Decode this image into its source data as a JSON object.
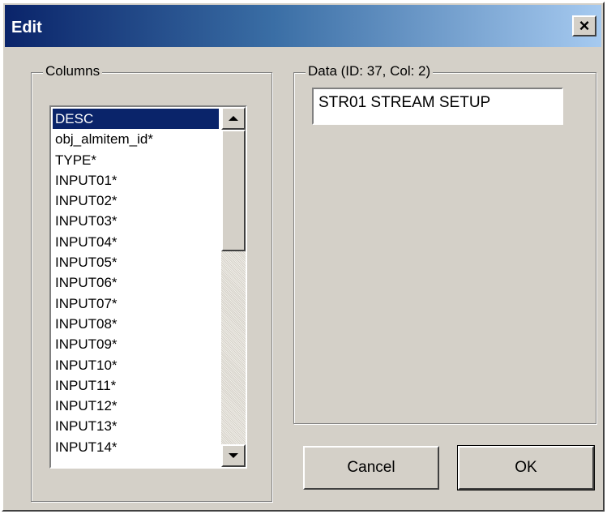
{
  "window": {
    "title": "Edit",
    "close_glyph": "×"
  },
  "columns_group": {
    "label": "Columns",
    "items": [
      "DESC",
      "obj_almitem_id*",
      "TYPE*",
      "INPUT01*",
      "INPUT02*",
      "INPUT03*",
      "INPUT04*",
      "INPUT05*",
      "INPUT06*",
      "INPUT07*",
      "INPUT08*",
      "INPUT09*",
      "INPUT10*",
      "INPUT11*",
      "INPUT12*",
      "INPUT13*",
      "INPUT14*"
    ],
    "selected_item": "DESC"
  },
  "data_group": {
    "label": "Data (ID: 37, Col: 2)",
    "value": "STR01 STREAM SETUP"
  },
  "buttons": {
    "cancel_label": "Cancel",
    "ok_label": "OK"
  },
  "colors": {
    "title_bar_start": "#0a246a",
    "title_bar_end": "#a6caf0",
    "selection": "#0a246a",
    "face": "#d4d0c8"
  }
}
